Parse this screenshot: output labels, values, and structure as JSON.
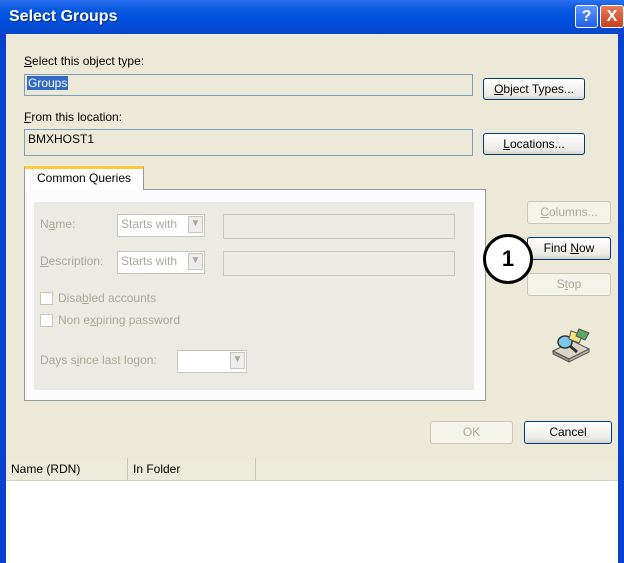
{
  "window": {
    "title": "Select Groups",
    "help_glyph": "?",
    "close_glyph": "X"
  },
  "object_type": {
    "label_prefix": "S",
    "label_rest": "elect this object type:",
    "value": "Groups",
    "button_prefix": "O",
    "button_rest": "bject Types..."
  },
  "location": {
    "label_prefix": "F",
    "label_rest": "rom this location:",
    "value": "BMXHOST1",
    "button_prefix": "L",
    "button_rest": "ocations..."
  },
  "tab": {
    "label": "Common Queries"
  },
  "queries": {
    "name_label_pre": "N",
    "name_label_u": "a",
    "name_label_post": "me:",
    "name_combo": "Starts with",
    "description_label_pre": "",
    "description_label_u": "D",
    "description_label_post": "escription:",
    "description_combo": "Starts with",
    "disabled_pre": "Disa",
    "disabled_u": "b",
    "disabled_post": "led accounts",
    "nonexpiring_pre": "Non e",
    "nonexpiring_u": "x",
    "nonexpiring_post": "piring password",
    "days_pre": "Days s",
    "days_u": "i",
    "days_post": "nce last logon:",
    "days_combo": ""
  },
  "side_buttons": {
    "columns_pre": "",
    "columns_u": "C",
    "columns_post": "olumns...",
    "find_pre": "Find ",
    "find_u": "N",
    "find_post": "ow",
    "stop_pre": "S",
    "stop_u": "t",
    "stop_post": "op"
  },
  "callout": {
    "number": "1"
  },
  "footer": {
    "ok_label": "OK",
    "cancel_label": "Cancel"
  },
  "results": {
    "columns": [
      "Name (RDN)",
      "In Folder"
    ]
  }
}
